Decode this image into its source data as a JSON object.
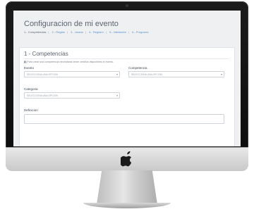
{
  "header": {
    "title": "Configuracion de mi evento",
    "steps": [
      "1.- Competencias",
      "2.- Reglas",
      "3.- Jurado",
      "4.- Registro",
      "5.- Validación",
      "6.- Programa"
    ]
  },
  "section": {
    "title": "1 - Competencias",
    "hint_bold": "(i)",
    "hint_text": " Para crear una competencia necesitaras tener creditos disponibles el evento."
  },
  "form": {
    "evento": {
      "label": "Evento",
      "placeholder": "SELECCIONA UNA OPCION"
    },
    "competencia": {
      "label": "Competencia",
      "placeholder": "SELECCIONA UNA OPCION"
    },
    "categoria": {
      "label": "Categoria",
      "placeholder": "SELECCIONA UNA OPCION"
    },
    "definicion": {
      "label": "Definicion"
    }
  },
  "colors": {
    "link": "#5a8fd0",
    "screen_bg": "#eef0f2"
  },
  "icons": {
    "dropdown": "caret-down",
    "logo": "apple-logo"
  }
}
